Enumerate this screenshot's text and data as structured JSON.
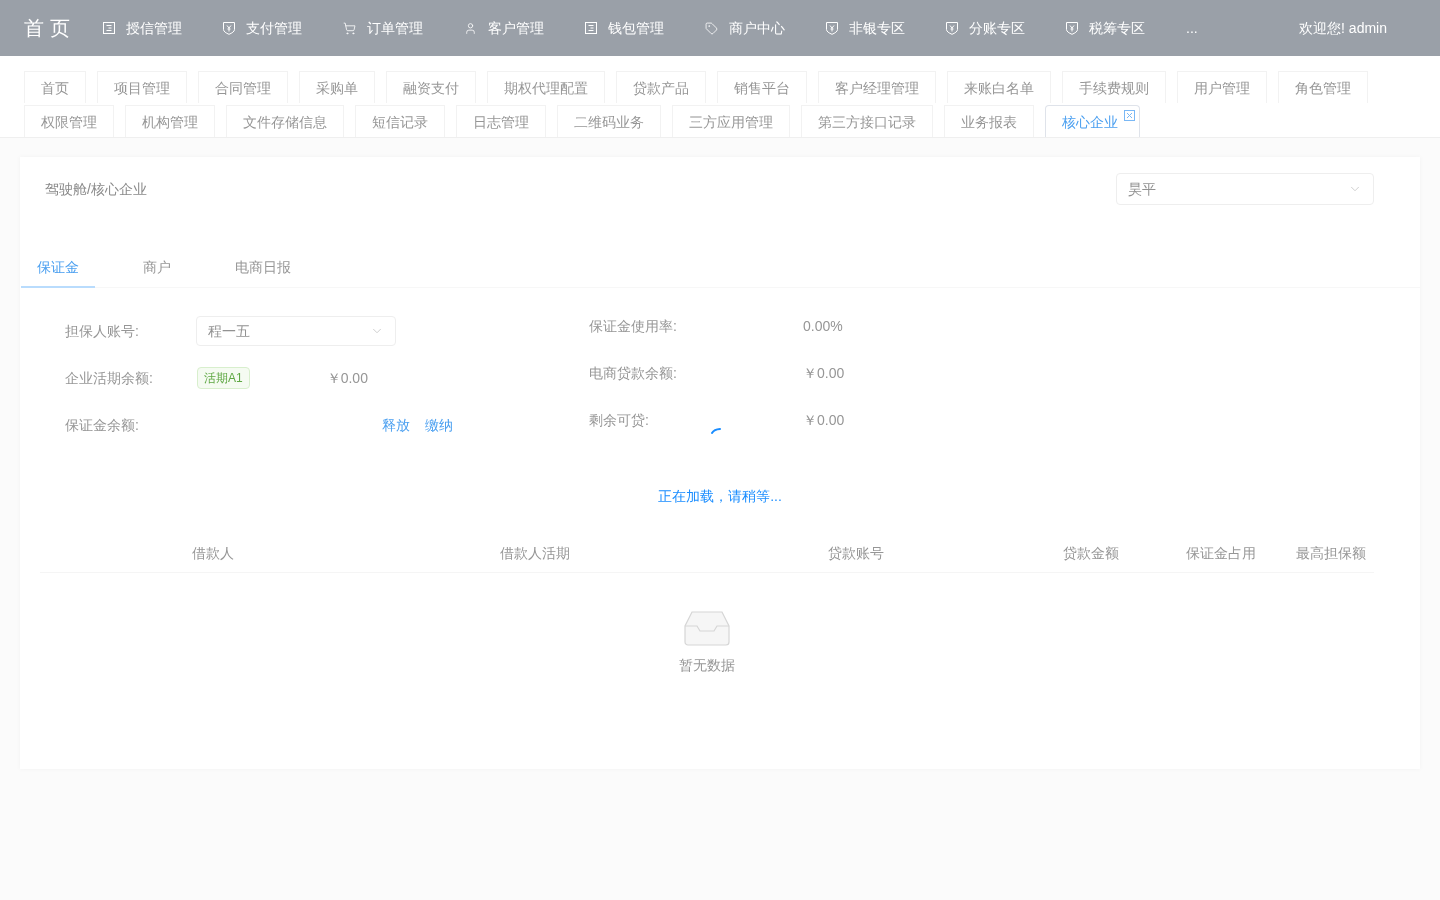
{
  "top_nav": {
    "logo": "首页",
    "items": [
      {
        "label": "授信管理",
        "kind": "doc"
      },
      {
        "label": "支付管理",
        "kind": "shield"
      },
      {
        "label": "订单管理",
        "kind": "cart"
      },
      {
        "label": "客户管理",
        "kind": "user"
      },
      {
        "label": "钱包管理",
        "kind": "doc"
      },
      {
        "label": "商户中心",
        "kind": "tag"
      },
      {
        "label": "非银专区",
        "kind": "shield"
      },
      {
        "label": "分账专区",
        "kind": "shield"
      },
      {
        "label": "税筹专区",
        "kind": "shield"
      }
    ],
    "more": "...",
    "welcome": "欢迎您! admin"
  },
  "open_tabs": [
    {
      "label": "首页",
      "selected": false
    },
    {
      "label": "项目管理",
      "selected": false
    },
    {
      "label": "合同管理",
      "selected": false
    },
    {
      "label": "采购单",
      "selected": false
    },
    {
      "label": "融资支付",
      "selected": false
    },
    {
      "label": "期权代理配置",
      "selected": false
    },
    {
      "label": "贷款产品",
      "selected": false
    },
    {
      "label": "销售平台",
      "selected": false
    },
    {
      "label": "客户经理管理",
      "selected": false
    },
    {
      "label": "来账白名单",
      "selected": false
    },
    {
      "label": "手续费规则",
      "selected": false
    },
    {
      "label": "用户管理",
      "selected": false
    },
    {
      "label": "角色管理",
      "selected": false
    },
    {
      "label": "权限管理",
      "selected": false
    },
    {
      "label": "机构管理",
      "selected": false
    },
    {
      "label": "文件存储信息",
      "selected": false
    },
    {
      "label": "短信记录",
      "selected": false
    },
    {
      "label": "日志管理",
      "selected": false
    },
    {
      "label": "二维码业务",
      "selected": false
    },
    {
      "label": "三方应用管理",
      "selected": false
    },
    {
      "label": "第三方接口记录",
      "selected": false
    },
    {
      "label": "业务报表",
      "selected": false
    },
    {
      "label": "核心企业",
      "selected": true
    }
  ],
  "page": {
    "breadcrumb": "驾驶舱/核心企业",
    "enterprise_select": {
      "value": "昊平"
    },
    "tabs": [
      {
        "label": "保证金",
        "selected": true
      },
      {
        "label": "商户",
        "selected": false
      },
      {
        "label": "电商日报",
        "selected": false
      }
    ],
    "form": {
      "left": [
        {
          "kind": "select",
          "label": "担保人账号:",
          "value": "程一五"
        },
        {
          "kind": "tag_amount",
          "label": "企业活期余额:",
          "tag": "活期A1",
          "value": "￥0.00"
        },
        {
          "kind": "actions",
          "label": "保证金余额:",
          "actions": [
            "释放",
            "缴纳"
          ]
        }
      ],
      "right": [
        {
          "label": "保证金使用率:",
          "value": "0.00%"
        },
        {
          "label": "电商贷款余额:",
          "value": "￥0.00"
        },
        {
          "label": "剩余可贷:",
          "value": "￥0.00"
        }
      ]
    },
    "table": {
      "columns": [
        "借款人",
        "借款人活期",
        "贷款账号",
        "贷款金额",
        "保证金占用",
        "最高担保额"
      ],
      "empty_text": "暂无数据"
    }
  },
  "loading": {
    "text": "正在加载，请稍等..."
  }
}
